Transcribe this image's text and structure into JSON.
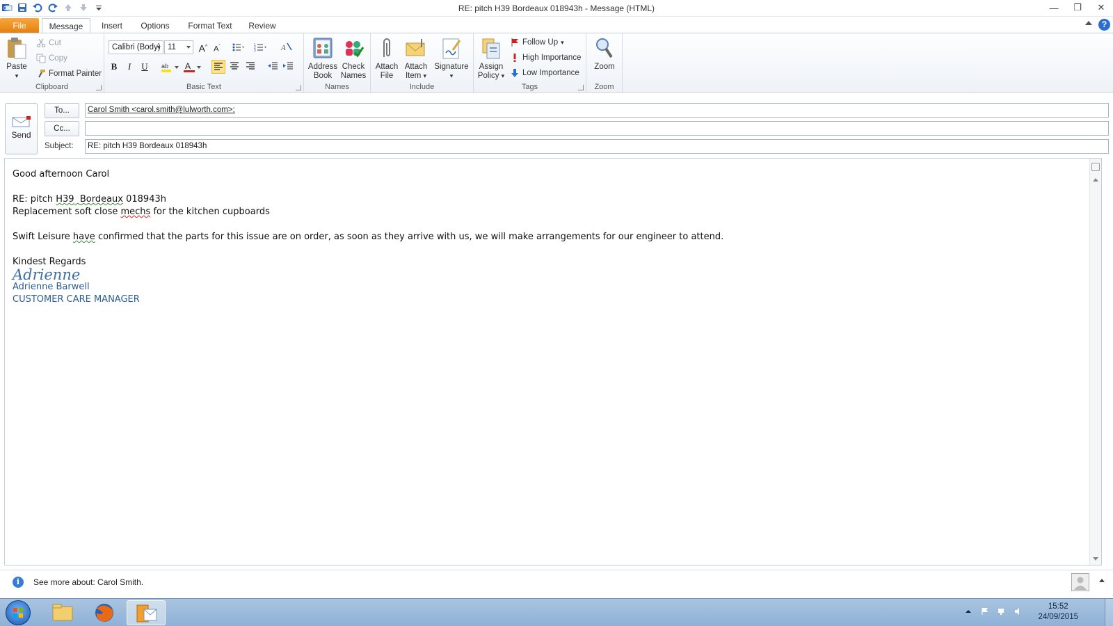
{
  "window": {
    "title": "RE: pitch H39  Bordeaux 018943h  -  Message (HTML)",
    "minimize": "—",
    "restore": "❐",
    "close": "✕"
  },
  "tabs": [
    {
      "label": "File"
    },
    {
      "label": "Message"
    },
    {
      "label": "Insert"
    },
    {
      "label": "Options"
    },
    {
      "label": "Format Text"
    },
    {
      "label": "Review"
    }
  ],
  "ribbon": {
    "clipboard": {
      "label": "Clipboard",
      "paste": "Paste",
      "cut": "Cut",
      "copy": "Copy",
      "format_painter": "Format Painter"
    },
    "basic_text": {
      "label": "Basic Text",
      "font": "Calibri (Body)",
      "size": "11",
      "bold": "B",
      "italic": "I",
      "underline": "U",
      "highlight_color": "#f5e12a",
      "font_color": "#d81e1e"
    },
    "names": {
      "label": "Names",
      "address_book": "Address Book",
      "check_names": "Check Names"
    },
    "include": {
      "label": "Include",
      "attach_file": "Attach File",
      "attach_item": "Attach Item",
      "signature": "Signature"
    },
    "tags": {
      "label": "Tags",
      "assign_policy": "Assign Policy",
      "follow_up": "Follow Up",
      "high_importance": "High Importance",
      "low_importance": "Low Importance"
    },
    "zoom": {
      "label": "Zoom",
      "zoom": "Zoom"
    }
  },
  "header": {
    "send": "Send",
    "to_button": "To...",
    "cc_button": "Cc...",
    "subject_label": "Subject:",
    "to_value": "Carol Smith <carol.smith@lulworth.com>;",
    "cc_value": "",
    "subject_value": "RE: pitch H39  Bordeaux 018943h"
  },
  "body": {
    "greeting": "Good afternoon Carol",
    "re_prefix": "RE: pitch ",
    "re_pitch": "H39",
    "re_mid": "  ",
    "re_bordeaux": "Bordeaux",
    "re_ref": " 018943h",
    "replace_pre": "Replacement soft close ",
    "replace_mechs": "mechs",
    "replace_post": " for the kitchen cupboards",
    "conf_pre": "Swift Leisure ",
    "conf_have": "have",
    "conf_post": " confirmed that the parts for this issue are on order, as soon as they arrive with us, we will make arrangements for our engineer to attend.",
    "regards": "Kindest Regards",
    "signature_script": "Adrienne",
    "sig_name": "Adrienne Barwell",
    "sig_title": "CUSTOMER CARE MANAGER"
  },
  "people_pane": {
    "text": "See more about: Carol Smith."
  },
  "taskbar": {
    "time": "15:52",
    "date": "24/09/2015"
  },
  "colors": {
    "file_tab": "#e57e0c",
    "accent_blue": "#2d5c8f",
    "taskbar": "#a9c4e0"
  }
}
